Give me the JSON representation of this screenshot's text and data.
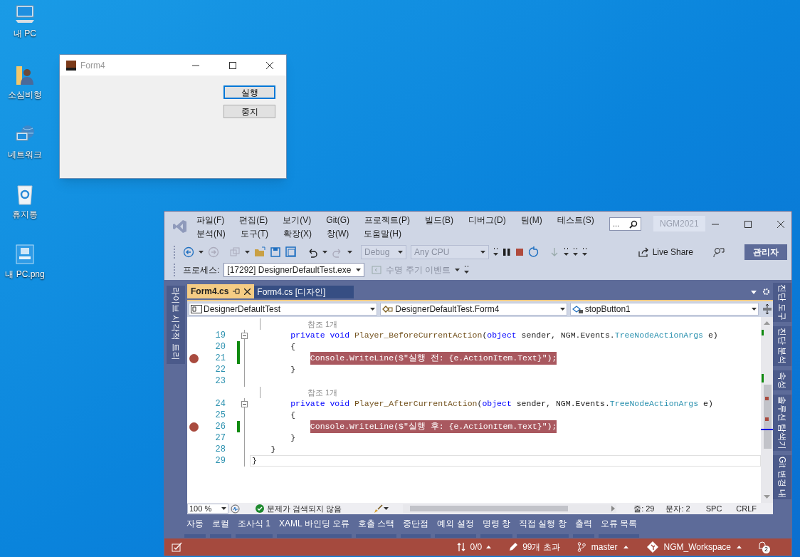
{
  "desktop_icons": [
    {
      "label": "내 PC",
      "kind": "computer"
    },
    {
      "label": "소심비형",
      "kind": "user-folder"
    },
    {
      "label": "네트워크",
      "kind": "network"
    },
    {
      "label": "휴지통",
      "kind": "recycle-bin"
    },
    {
      "label": "내 PC.png",
      "kind": "image-file"
    }
  ],
  "form_window": {
    "title": "Form4",
    "buttons": [
      {
        "label": "실행",
        "focused": true
      },
      {
        "label": "중지",
        "focused": false
      }
    ]
  },
  "ide": {
    "menu": [
      "파일(F)",
      "편집(E)",
      "보기(V)",
      "Git(G)",
      "프로젝트(P)",
      "빌드(B)",
      "디버그(D)",
      "팀(M)",
      "테스트(S)",
      "분석(N)",
      "도구(T)",
      "확장(X)",
      "창(W)",
      "도움말(H)"
    ],
    "search_box": "...",
    "solution_name": "NGM2021",
    "toolbar": {
      "configuration": "Debug",
      "platform": "Any CPU",
      "live_share": "Live Share",
      "admin_badge": "관리자"
    },
    "process_bar": {
      "label": "프로세스:",
      "process": "[17292] DesignerDefaultTest.exe",
      "lifecycle_events": "수명 주기 이벤트"
    },
    "left_tool_tab": "라이브 시각적 트리",
    "tabs": [
      {
        "label": "Form4.cs",
        "selected": true
      },
      {
        "label": "Form4.cs [디자인]",
        "selected": false
      }
    ],
    "navigation": [
      "DesignerDefaultTest",
      "DesignerDefaultTest.Form4",
      "stopButton1"
    ],
    "code_lines": [
      {
        "kind": "codelens",
        "text": "참조 1개"
      },
      {
        "kind": "code",
        "number": "19",
        "breakpoint": false,
        "changed": false,
        "foldable": true,
        "current": false,
        "segments": [
          {
            "text": "        private void",
            "kind": "keyword"
          },
          {
            "text": " Player_BeforeCurrentAction",
            "kind": "method"
          },
          {
            "text": "(",
            "kind": "plain"
          },
          {
            "text": "object",
            "kind": "keyword"
          },
          {
            "text": " sender, NGM.Events.",
            "kind": "plain"
          },
          {
            "text": "TreeNodeActionArgs",
            "kind": "type"
          },
          {
            "text": " e)",
            "kind": "plain"
          }
        ]
      },
      {
        "kind": "code",
        "number": "20",
        "breakpoint": false,
        "changed": true,
        "foldable": false,
        "current": false,
        "segments": [
          {
            "text": "        {",
            "kind": "plain"
          }
        ]
      },
      {
        "kind": "code",
        "number": "21",
        "breakpoint": true,
        "changed": true,
        "foldable": false,
        "current": false,
        "segments": [
          {
            "text": "            Console.WriteLine($\"실행 전: {e.ActionItem.Text}\");",
            "kind": "plain"
          }
        ]
      },
      {
        "kind": "code",
        "number": "22",
        "breakpoint": false,
        "changed": false,
        "foldable": false,
        "current": false,
        "segments": [
          {
            "text": "        }",
            "kind": "plain"
          }
        ]
      },
      {
        "kind": "code",
        "number": "23",
        "breakpoint": false,
        "changed": false,
        "foldable": false,
        "current": false
      },
      {
        "kind": "codelens",
        "text": "참조 1개"
      },
      {
        "kind": "code",
        "number": "24",
        "breakpoint": false,
        "changed": false,
        "foldable": true,
        "current": false,
        "segments": [
          {
            "text": "        private void",
            "kind": "keyword"
          },
          {
            "text": " Player_AfterCurrentAction",
            "kind": "method"
          },
          {
            "text": "(",
            "kind": "plain"
          },
          {
            "text": "object",
            "kind": "keyword"
          },
          {
            "text": " sender, NGM.Events.",
            "kind": "plain"
          },
          {
            "text": "TreeNodeActionArgs",
            "kind": "type"
          },
          {
            "text": " e)",
            "kind": "plain"
          }
        ]
      },
      {
        "kind": "code",
        "number": "25",
        "breakpoint": false,
        "changed": false,
        "foldable": false,
        "current": false,
        "segments": [
          {
            "text": "        {",
            "kind": "plain"
          }
        ]
      },
      {
        "kind": "code",
        "number": "26",
        "breakpoint": true,
        "changed": true,
        "foldable": false,
        "current": false,
        "segments": [
          {
            "text": "            Console.WriteLine($\"실행 후: {e.ActionItem.Text}\");",
            "kind": "plain"
          }
        ]
      },
      {
        "kind": "code",
        "number": "27",
        "breakpoint": false,
        "changed": false,
        "foldable": false,
        "current": false,
        "segments": [
          {
            "text": "        }",
            "kind": "plain"
          }
        ]
      },
      {
        "kind": "code",
        "number": "28",
        "breakpoint": false,
        "changed": false,
        "foldable": false,
        "current": false,
        "segments": [
          {
            "text": "    }",
            "kind": "plain"
          }
        ]
      },
      {
        "kind": "code",
        "number": "29",
        "breakpoint": false,
        "changed": false,
        "foldable": false,
        "current": true,
        "segments": [
          {
            "text": "}",
            "kind": "plain"
          }
        ]
      }
    ],
    "editor_status": {
      "zoom": "100 %",
      "issues": "문제가 검색되지 않음",
      "line": "줄: 29",
      "column": "문자: 2",
      "whitespace": "SPC",
      "line_ending": "CRLF"
    },
    "tool_tabs": [
      "자동",
      "로컬",
      "조사식 1",
      "XAML 바인딩 오류",
      "호출 스택",
      "중단점",
      "예외 설정",
      "명령 창",
      "직접 실행 창",
      "출력",
      "오류 목록"
    ],
    "right_tool_tabs": [
      "진단 도구",
      "진단 분석",
      "속성",
      "솔루션 탐색기",
      "Git 변경 내"
    ],
    "status_bar": {
      "changes": "0/0",
      "edits": "99개 초과",
      "branch": "master",
      "repository": "NGM_Workspace",
      "notifications": "2"
    }
  }
}
